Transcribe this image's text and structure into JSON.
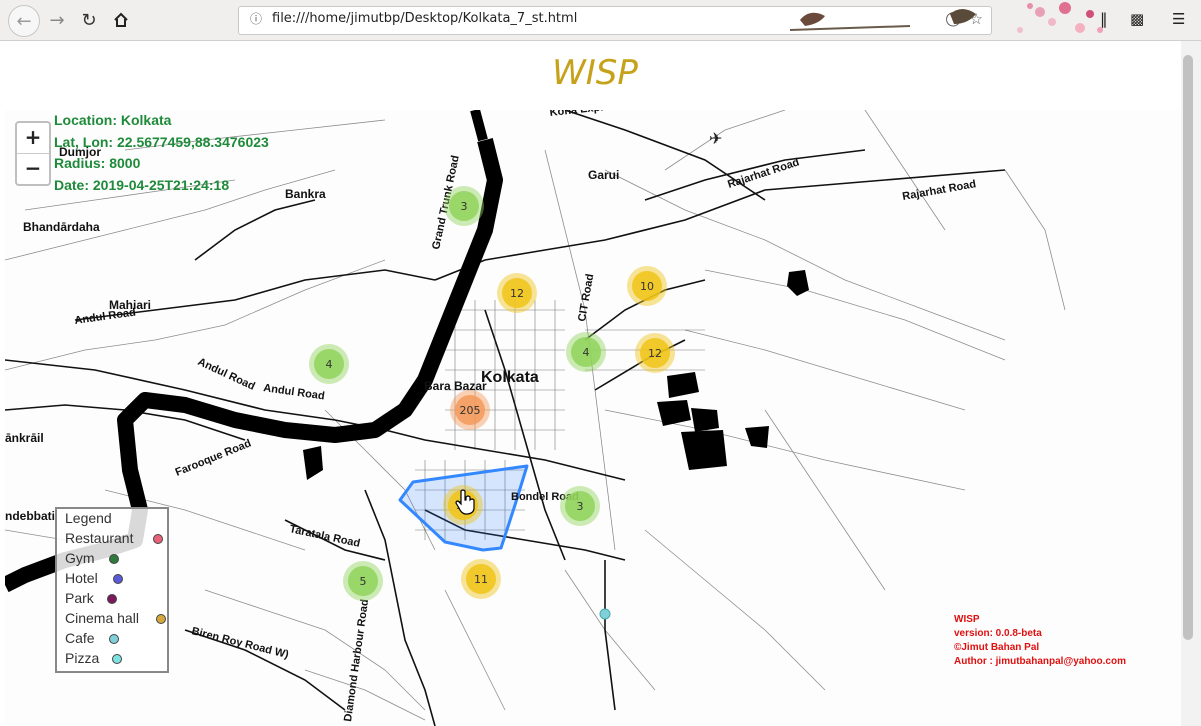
{
  "browser": {
    "url": "file:///home/jimutbp/Desktop/Kolkata_7_st.html"
  },
  "page": {
    "title": "WISP"
  },
  "info": {
    "location": "Location: Kolkata",
    "latlon": "Lat, Lon: 22.5677459,88.3476023",
    "radius": "Radius: 8000",
    "date": "Date: 2019-04-25T21:24:18"
  },
  "zoom": {
    "in": "+",
    "out": "−"
  },
  "map_labels": {
    "places": [
      "Dumjor",
      "Bankra",
      "Bhandārdaha",
      "Mahiari",
      "Garui",
      "Kolkata",
      "Bara Bazar",
      "ānkrāil",
      "ndebbati"
    ],
    "roads": [
      "Andul Road",
      "Andul Road",
      "Andul Road",
      "Grand Trunk Road",
      "Rajarhat Road",
      "Rajarhat Road",
      "Farooque Road",
      "Taratala Road",
      "Bondel Road",
      "Biren Roy Road W)",
      "Diamond Harbour Road",
      "CIT Road",
      "Kona Expressway"
    ]
  },
  "clusters": [
    {
      "count": "3",
      "level": "small"
    },
    {
      "count": "12",
      "level": "medium"
    },
    {
      "count": "10",
      "level": "medium"
    },
    {
      "count": "4",
      "level": "small"
    },
    {
      "count": "4",
      "level": "small"
    },
    {
      "count": "12",
      "level": "medium"
    },
    {
      "count": "205",
      "level": "large"
    },
    {
      "count": "31",
      "level": "medium"
    },
    {
      "count": "3",
      "level": "small"
    },
    {
      "count": "5",
      "level": "small"
    },
    {
      "count": "11",
      "level": "medium"
    }
  ],
  "legend": {
    "title": "Legend",
    "items": [
      {
        "label": "Restaurant",
        "color": "#e8637a"
      },
      {
        "label": "Gym",
        "color": "#2f7a3a"
      },
      {
        "label": "Hotel",
        "color": "#5b5bd8"
      },
      {
        "label": "Park",
        "color": "#7a1a5a"
      },
      {
        "label": "Cinema hall",
        "color": "#d4a83a"
      },
      {
        "label": "Cafe",
        "color": "#7fd0d8"
      },
      {
        "label": "Pizza",
        "color": "#7fe0e0"
      }
    ]
  },
  "footer": {
    "name": "WISP",
    "version": "version: 0.0.8-beta",
    "copyright": "©Jimut Bahan Pal",
    "author": "Author : jimutbahanpal@yahoo.com"
  },
  "colors": {
    "title": "#c5a21a",
    "info": "#1e8a3a",
    "footer": "#e01010",
    "cluster_small": "#8fd35a",
    "cluster_medium": "#f0c419",
    "cluster_large": "#f39a5a",
    "polygon": "#3388ff"
  }
}
